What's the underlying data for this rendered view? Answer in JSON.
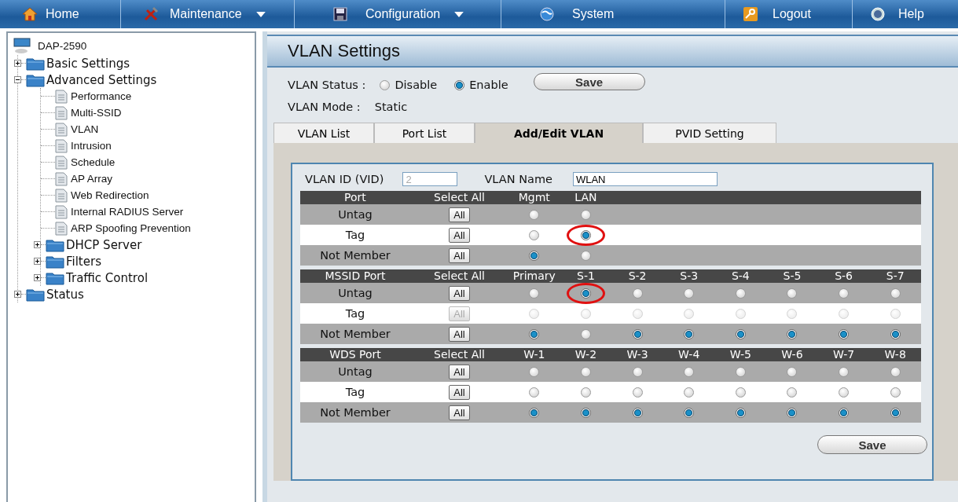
{
  "nav": [
    {
      "label": "Home",
      "dropdown": false
    },
    {
      "label": "Maintenance",
      "dropdown": true
    },
    {
      "label": "Configuration",
      "dropdown": true
    },
    {
      "label": "System",
      "dropdown": false
    },
    {
      "label": "Logout",
      "dropdown": false
    },
    {
      "label": "Help",
      "dropdown": false
    }
  ],
  "sidebar": {
    "root": "DAP-2590",
    "items": [
      {
        "label": "Basic Settings",
        "kind": "folder",
        "expanded": false
      },
      {
        "label": "Advanced Settings",
        "kind": "folder",
        "expanded": true,
        "children": [
          {
            "label": "Performance",
            "kind": "page"
          },
          {
            "label": "Multi-SSID",
            "kind": "page"
          },
          {
            "label": "VLAN",
            "kind": "page"
          },
          {
            "label": "Intrusion",
            "kind": "page"
          },
          {
            "label": "Schedule",
            "kind": "page"
          },
          {
            "label": "AP Array",
            "kind": "page"
          },
          {
            "label": "Web Redirection",
            "kind": "page"
          },
          {
            "label": "Internal RADIUS Server",
            "kind": "page"
          },
          {
            "label": "ARP Spoofing Prevention",
            "kind": "page"
          },
          {
            "label": "DHCP Server",
            "kind": "folder",
            "expanded": false
          },
          {
            "label": "Filters",
            "kind": "folder",
            "expanded": false
          },
          {
            "label": "Traffic Control",
            "kind": "folder",
            "expanded": false
          }
        ]
      },
      {
        "label": "Status",
        "kind": "folder",
        "expanded": false
      }
    ]
  },
  "panel": {
    "title": "VLAN Settings",
    "status": {
      "label": "VLAN Status :",
      "options": [
        {
          "label": "Disable",
          "selected": false
        },
        {
          "label": "Enable",
          "selected": true
        }
      ],
      "save": "Save"
    },
    "mode": {
      "label": "VLAN Mode :",
      "value": "Static"
    },
    "tabs": [
      {
        "label": "VLAN List",
        "selected": false
      },
      {
        "label": "Port List",
        "selected": false
      },
      {
        "label": "Add/Edit VLAN",
        "selected": true
      },
      {
        "label": "PVID Setting",
        "selected": false
      }
    ],
    "vlan_id": {
      "label": "VLAN ID (VID)",
      "value": "2",
      "disabled": true
    },
    "vlan_name": {
      "label": "VLAN Name",
      "value": "WLAN"
    },
    "tables": [
      {
        "headers": [
          "Port",
          "Select All",
          "Mgmt",
          "LAN"
        ],
        "rows": [
          {
            "label": "Untag",
            "all": "All",
            "all_disabled": false,
            "radios": [
              {
                "selected": false,
                "disabled": false,
                "circled": false
              },
              {
                "selected": false,
                "disabled": false,
                "circled": false
              }
            ]
          },
          {
            "label": "Tag",
            "all": "All",
            "all_disabled": false,
            "radios": [
              {
                "selected": false,
                "disabled": false,
                "circled": false
              },
              {
                "selected": true,
                "disabled": false,
                "circled": true
              }
            ]
          },
          {
            "label": "Not Member",
            "all": "All",
            "all_disabled": false,
            "radios": [
              {
                "selected": true,
                "disabled": false,
                "circled": false
              },
              {
                "selected": false,
                "disabled": false,
                "circled": false
              }
            ]
          }
        ]
      },
      {
        "headers": [
          "MSSID Port",
          "Select All",
          "Primary",
          "S-1",
          "S-2",
          "S-3",
          "S-4",
          "S-5",
          "S-6",
          "S-7"
        ],
        "rows": [
          {
            "label": "Untag",
            "all": "All",
            "all_disabled": false,
            "radios": [
              {
                "selected": false,
                "disabled": false,
                "circled": false
              },
              {
                "selected": true,
                "disabled": false,
                "circled": true
              },
              {
                "selected": false,
                "disabled": false,
                "circled": false
              },
              {
                "selected": false,
                "disabled": false,
                "circled": false
              },
              {
                "selected": false,
                "disabled": false,
                "circled": false
              },
              {
                "selected": false,
                "disabled": false,
                "circled": false
              },
              {
                "selected": false,
                "disabled": false,
                "circled": false
              },
              {
                "selected": false,
                "disabled": false,
                "circled": false
              }
            ]
          },
          {
            "label": "Tag",
            "all": "All",
            "all_disabled": true,
            "radios": [
              {
                "selected": false,
                "disabled": true,
                "circled": false
              },
              {
                "selected": false,
                "disabled": true,
                "circled": false
              },
              {
                "selected": false,
                "disabled": true,
                "circled": false
              },
              {
                "selected": false,
                "disabled": true,
                "circled": false
              },
              {
                "selected": false,
                "disabled": true,
                "circled": false
              },
              {
                "selected": false,
                "disabled": true,
                "circled": false
              },
              {
                "selected": false,
                "disabled": true,
                "circled": false
              },
              {
                "selected": false,
                "disabled": true,
                "circled": false
              }
            ]
          },
          {
            "label": "Not Member",
            "all": "All",
            "all_disabled": false,
            "radios": [
              {
                "selected": true,
                "disabled": false,
                "circled": false
              },
              {
                "selected": false,
                "disabled": false,
                "circled": false
              },
              {
                "selected": true,
                "disabled": false,
                "circled": false
              },
              {
                "selected": true,
                "disabled": false,
                "circled": false
              },
              {
                "selected": true,
                "disabled": false,
                "circled": false
              },
              {
                "selected": true,
                "disabled": false,
                "circled": false
              },
              {
                "selected": true,
                "disabled": false,
                "circled": false
              },
              {
                "selected": true,
                "disabled": false,
                "circled": false
              }
            ]
          }
        ]
      },
      {
        "headers": [
          "WDS Port",
          "Select All",
          "W-1",
          "W-2",
          "W-3",
          "W-4",
          "W-5",
          "W-6",
          "W-7",
          "W-8"
        ],
        "rows": [
          {
            "label": "Untag",
            "all": "All",
            "all_disabled": false,
            "radios": [
              {
                "selected": false,
                "disabled": false,
                "circled": false
              },
              {
                "selected": false,
                "disabled": false,
                "circled": false
              },
              {
                "selected": false,
                "disabled": false,
                "circled": false
              },
              {
                "selected": false,
                "disabled": false,
                "circled": false
              },
              {
                "selected": false,
                "disabled": false,
                "circled": false
              },
              {
                "selected": false,
                "disabled": false,
                "circled": false
              },
              {
                "selected": false,
                "disabled": false,
                "circled": false
              },
              {
                "selected": false,
                "disabled": false,
                "circled": false
              }
            ]
          },
          {
            "label": "Tag",
            "all": "All",
            "all_disabled": false,
            "radios": [
              {
                "selected": false,
                "disabled": false,
                "circled": false
              },
              {
                "selected": false,
                "disabled": false,
                "circled": false
              },
              {
                "selected": false,
                "disabled": false,
                "circled": false
              },
              {
                "selected": false,
                "disabled": false,
                "circled": false
              },
              {
                "selected": false,
                "disabled": false,
                "circled": false
              },
              {
                "selected": false,
                "disabled": false,
                "circled": false
              },
              {
                "selected": false,
                "disabled": false,
                "circled": false
              },
              {
                "selected": false,
                "disabled": false,
                "circled": false
              }
            ]
          },
          {
            "label": "Not Member",
            "all": "All",
            "all_disabled": false,
            "radios": [
              {
                "selected": true,
                "disabled": false,
                "circled": false
              },
              {
                "selected": true,
                "disabled": false,
                "circled": false
              },
              {
                "selected": true,
                "disabled": false,
                "circled": false
              },
              {
                "selected": true,
                "disabled": false,
                "circled": false
              },
              {
                "selected": true,
                "disabled": false,
                "circled": false
              },
              {
                "selected": true,
                "disabled": false,
                "circled": false
              },
              {
                "selected": true,
                "disabled": false,
                "circled": false
              },
              {
                "selected": true,
                "disabled": false,
                "circled": false
              }
            ]
          }
        ]
      }
    ],
    "save": "Save"
  }
}
